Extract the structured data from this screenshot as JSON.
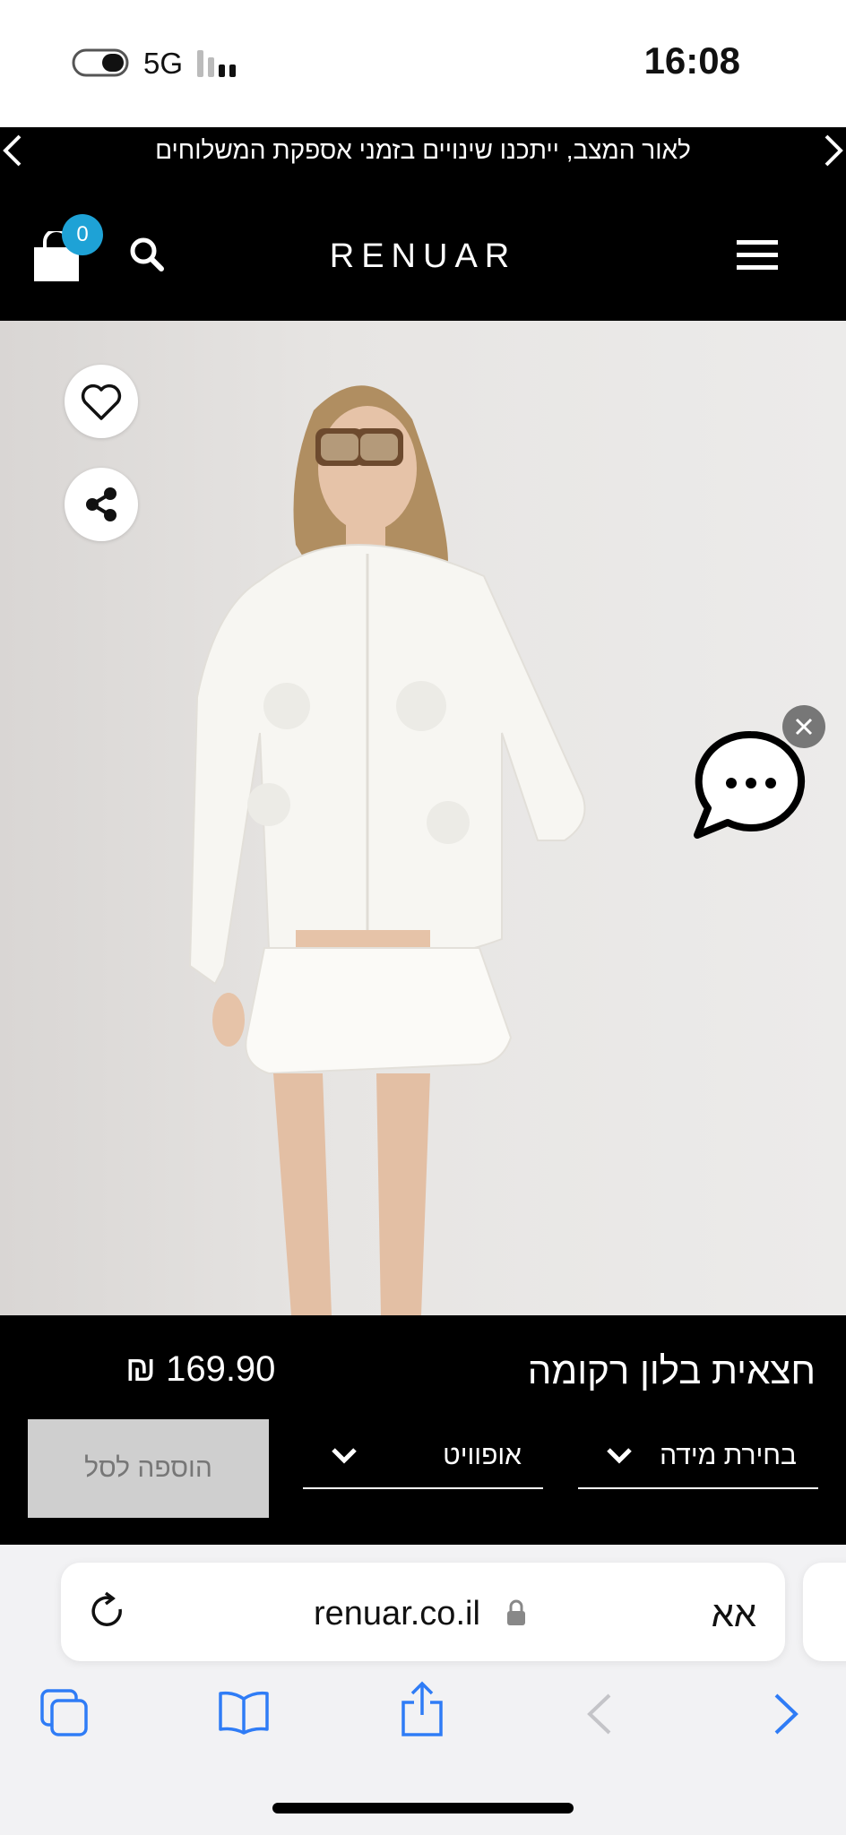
{
  "status_bar": {
    "network": "5G",
    "time": "16:08"
  },
  "announcement": {
    "text": "לאור המצב, ייתכנו שינויים בזמני אספקת המשלוחים"
  },
  "header": {
    "logo": "RENUAR",
    "cart_count": "0"
  },
  "product": {
    "title": "חצאית בלון רקומה",
    "price": "169.90 ₪",
    "size_select_label": "בחירת מידה",
    "color_select_label": "אופוויט",
    "add_to_cart_label": "הוספה לסל"
  },
  "browser": {
    "url": "renuar.co.il",
    "aa_label": "אא"
  },
  "colors": {
    "accent_badge": "#1ea2d6",
    "header_bg": "#000000",
    "safari_blue": "#2f7cf6"
  },
  "icons": [
    "heart-icon",
    "share-icon",
    "chat-icon",
    "close-icon",
    "search-icon",
    "cart-icon",
    "menu-icon",
    "lock-icon",
    "reload-icon",
    "tabs-icon",
    "bookmarks-icon",
    "share-sheet-icon",
    "back-icon",
    "forward-icon"
  ]
}
